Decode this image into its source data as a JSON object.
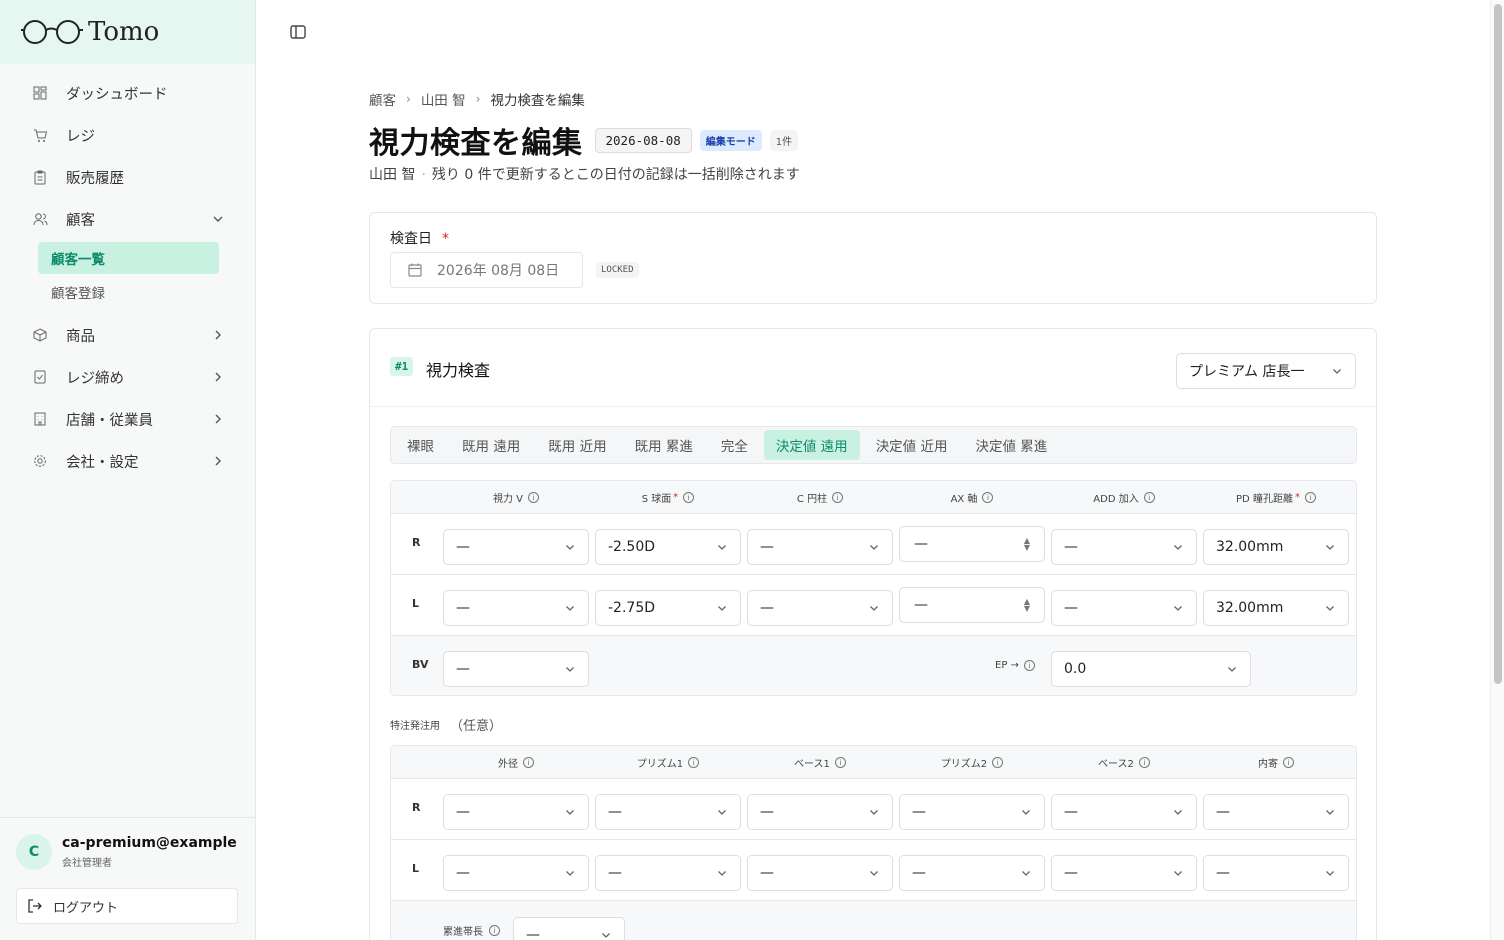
{
  "brand": {
    "name": "Tomo"
  },
  "sidebar": {
    "items": [
      {
        "label": "ダッシュボード"
      },
      {
        "label": "レジ"
      },
      {
        "label": "販売履歴"
      },
      {
        "label": "顧客"
      },
      {
        "label": "商品"
      },
      {
        "label": "レジ締め"
      },
      {
        "label": "店舗・従業員"
      },
      {
        "label": "会社・設定"
      }
    ],
    "sub_items": [
      {
        "label": "顧客一覧"
      },
      {
        "label": "顧客登録"
      }
    ]
  },
  "user": {
    "initial": "C",
    "email": "ca-premium@example....",
    "role": "会社管理者",
    "logout_label": "ログアウト"
  },
  "breadcrumb": [
    "顧客",
    "山田 智",
    "視力検査を編集"
  ],
  "header": {
    "title": "視力検査を編集",
    "date_badge": "2026-08-08",
    "mode_badge": "編集モード",
    "count_badge": "1件",
    "customer": "山田 智",
    "note": "残り 0 件で更新するとこの日付の記録は一括削除されます"
  },
  "exam_date": {
    "label": "検査日",
    "required_mark": "*",
    "value": "2026年 08月 08日",
    "locked_label": "LOCKED"
  },
  "exam": {
    "number": "#1",
    "title": "視力検査",
    "staff": "プレミアム 店長一",
    "tabs": [
      "裸眼",
      "既用 遠用",
      "既用 近用",
      "既用 累進",
      "完全",
      "決定値 遠用",
      "決定値 近用",
      "決定値 累進"
    ],
    "active_tab": "決定値 遠用",
    "columns": [
      {
        "label": "視力 V",
        "required": false
      },
      {
        "label": "S 球面",
        "required": true
      },
      {
        "label": "C 円柱",
        "required": false
      },
      {
        "label": "AX 軸",
        "required": false
      },
      {
        "label": "ADD 加入",
        "required": false
      },
      {
        "label": "PD 瞳孔距離",
        "required": true
      }
    ],
    "rows": [
      {
        "eye": "R",
        "values": [
          "—",
          "-2.50D",
          "—",
          "—",
          "—",
          "32.00mm"
        ]
      },
      {
        "eye": "L",
        "values": [
          "—",
          "-2.75D",
          "—",
          "—",
          "—",
          "32.00mm"
        ]
      }
    ],
    "bv": {
      "label": "BV",
      "value": "—",
      "ep_label": "EP →",
      "ep_value": "0.0"
    },
    "required_mark": "*",
    "info_glyph": "i",
    "stepper_up": "▲",
    "stepper_down": "▼"
  },
  "special_order": {
    "label": "特注発注用",
    "optional": "（任意）",
    "columns": [
      "外径",
      "プリズム1",
      "ベース1",
      "プリズム2",
      "ベース2",
      "内寄"
    ],
    "rows": [
      {
        "eye": "R",
        "values": [
          "—",
          "—",
          "—",
          "—",
          "—",
          "—"
        ]
      },
      {
        "eye": "L",
        "values": [
          "—",
          "—",
          "—",
          "—",
          "—",
          "—"
        ]
      }
    ],
    "progressive_label": "累進帯長",
    "progressive_value": "—"
  },
  "colors": {
    "accent": "#0f8a6b",
    "accent_bg": "#c8f1e2",
    "brand_bg": "#e6f7f1"
  }
}
